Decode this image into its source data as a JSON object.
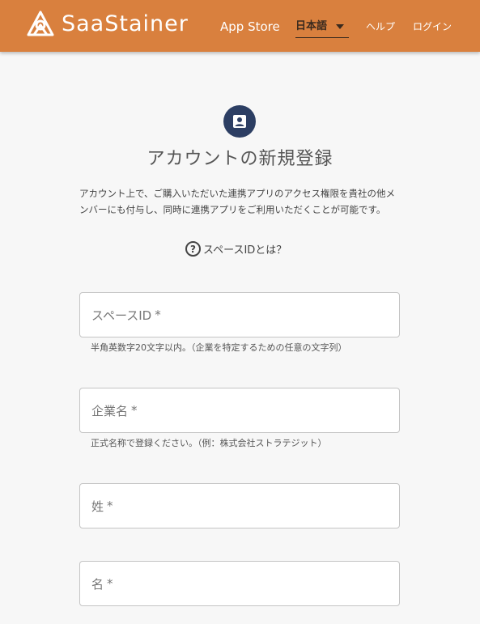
{
  "header": {
    "brand": "SaaStainer",
    "nav": {
      "app_store": "App Store",
      "language": "日本語",
      "help": "ヘルプ",
      "login": "ログイン"
    }
  },
  "main": {
    "title": "アカウントの新規登録",
    "description": "アカウント上で、ご購入いただいた連携アプリのアクセス権限を貴社の他メンバーにも付与し、同時に連携アプリをご利用いただくことが可能です。",
    "help_link": "スペースIDとは？",
    "fields": [
      {
        "label": "スペースID",
        "required": "*",
        "hint": "半角英数字20文字以内。（企業を特定するための任意の文字列）"
      },
      {
        "label": "企業名",
        "required": "*",
        "hint": "正式名称で登録ください。（例：株式会社ストラテジット）"
      },
      {
        "label": "姓",
        "required": "*",
        "hint": ""
      },
      {
        "label": "名",
        "required": "*",
        "hint": ""
      }
    ]
  },
  "colors": {
    "header_bg": "#d9803e",
    "badge_bg": "#2c3e63"
  },
  "icons": {
    "logo": "saastainer-logo-icon",
    "account": "account-box-icon",
    "help": "question-circle-icon",
    "dropdown": "caret-down-icon"
  }
}
